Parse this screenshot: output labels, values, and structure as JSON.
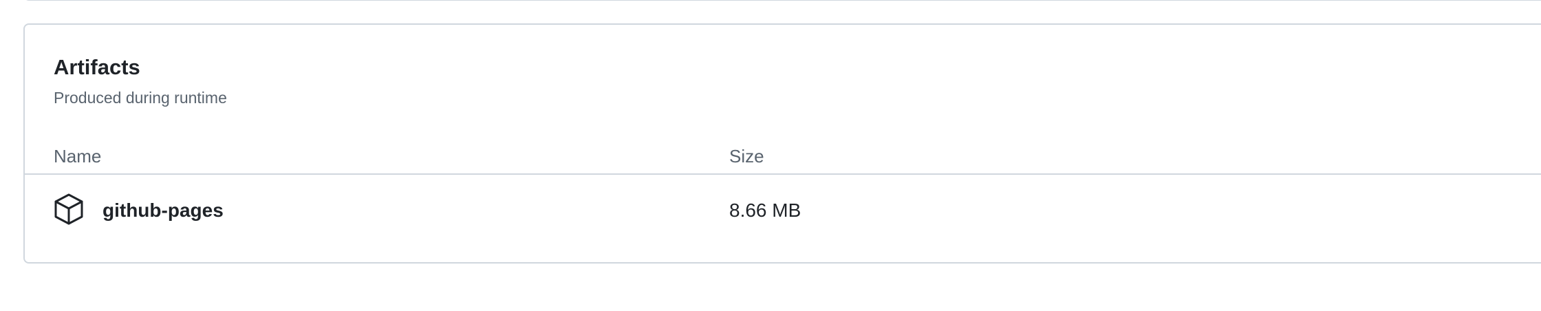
{
  "artifacts": {
    "title": "Artifacts",
    "subtitle": "Produced during runtime",
    "columns": {
      "name": "Name",
      "size": "Size"
    },
    "items": [
      {
        "name": "github-pages",
        "size": "8.66 MB",
        "icon": "package-icon"
      }
    ]
  },
  "colors": {
    "border": "#d0d7de",
    "text_primary": "#1f2328",
    "text_muted": "#59636e"
  }
}
